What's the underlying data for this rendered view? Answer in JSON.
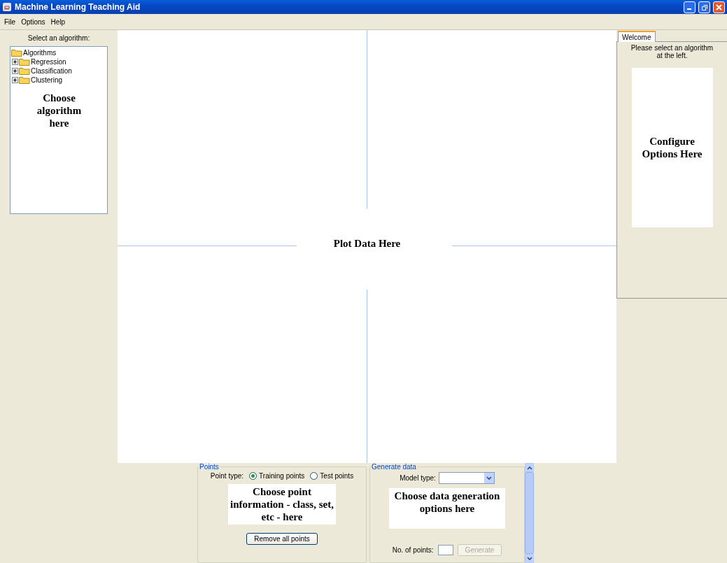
{
  "window": {
    "title": "Machine Learning Teaching Aid"
  },
  "menu": [
    "File",
    "Options",
    "Help"
  ],
  "algorithm_panel": {
    "label": "Select an algorithm:",
    "tree": {
      "label": "Algorithms",
      "children": [
        {
          "label": "Regression",
          "expanded": false
        },
        {
          "label": "Classification",
          "expanded": false
        },
        {
          "label": "Clustering",
          "expanded": false
        }
      ]
    },
    "note": "Choose algorithm here"
  },
  "plot": {
    "note": "Plot Data Here"
  },
  "options_panel": {
    "tabs": [
      {
        "label": "Welcome",
        "selected": true
      }
    ],
    "message": "Please select an algorithm at the left.",
    "note": "Configure Options Here"
  },
  "points_panel": {
    "title": "Points",
    "point_type_label": "Point type:",
    "point_types": [
      {
        "label": "Training points",
        "selected": true
      },
      {
        "label": "Test points",
        "selected": false
      }
    ],
    "note": "Choose point information - class, set, etc - here",
    "button": "Remove all points"
  },
  "generate_panel": {
    "title": "Generate data",
    "model_type_label": "Model type:",
    "note": "Choose data generation options here",
    "points_label": "No. of points:",
    "button": {
      "label": "Generate",
      "disabled": true
    }
  }
}
